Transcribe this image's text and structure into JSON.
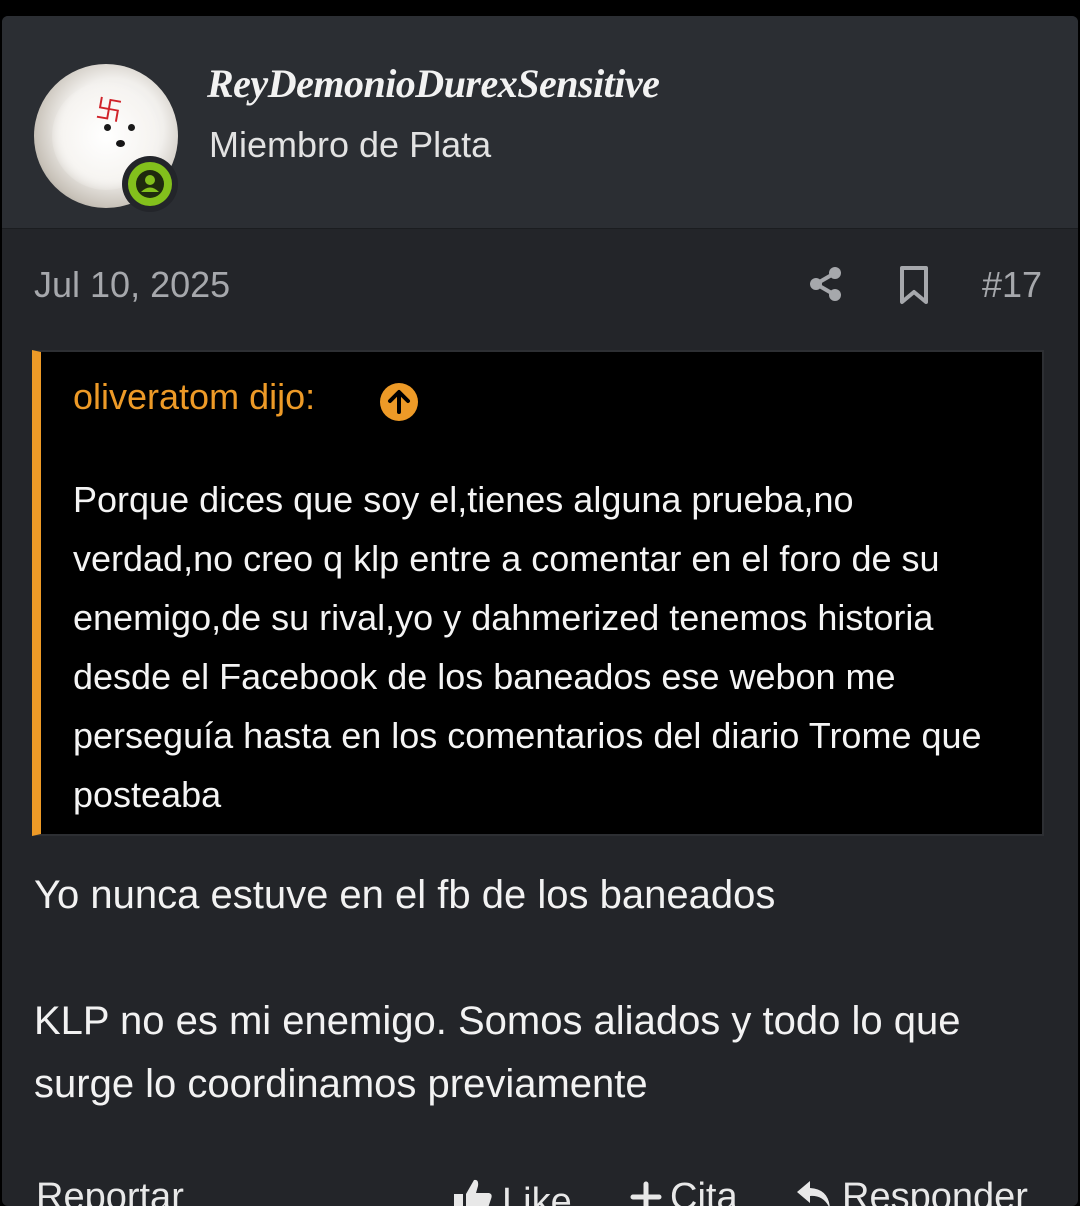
{
  "author": {
    "username": "ReyDemonioDurexSensitive",
    "title": "Miembro de Plata",
    "online_color": "#83c01c"
  },
  "post": {
    "date": "Jul 10, 2025",
    "number": "#17"
  },
  "quote": {
    "author_label": "oliveratom dijo:",
    "text": "Porque dices que soy el,tienes alguna prueba,no verdad,no creo q klp entre a comentar en el foro de su enemigo,de su rival,yo y dahmerized tenemos historia desde el Facebook de los baneados ese webon me perseguía hasta en los comentarios del diario Trome que posteaba",
    "accent_color": "#ed9a27"
  },
  "body": {
    "paragraph_1": "Yo nunca estuve en el fb de los baneados",
    "paragraph_2": "KLP no es mi enemigo. Somos aliados y todo lo que surge lo coordinamos previamente"
  },
  "actions": {
    "report": "Reportar",
    "like": "Like",
    "quote": "Cita",
    "reply": "Responder"
  },
  "icons": {
    "share": "share-icon",
    "bookmark": "bookmark-icon",
    "quote_jump": "arrow-up-circle-icon",
    "like": "thumbs-up-icon",
    "quote": "plus-icon",
    "reply": "reply-icon",
    "user_status": "user-icon"
  }
}
